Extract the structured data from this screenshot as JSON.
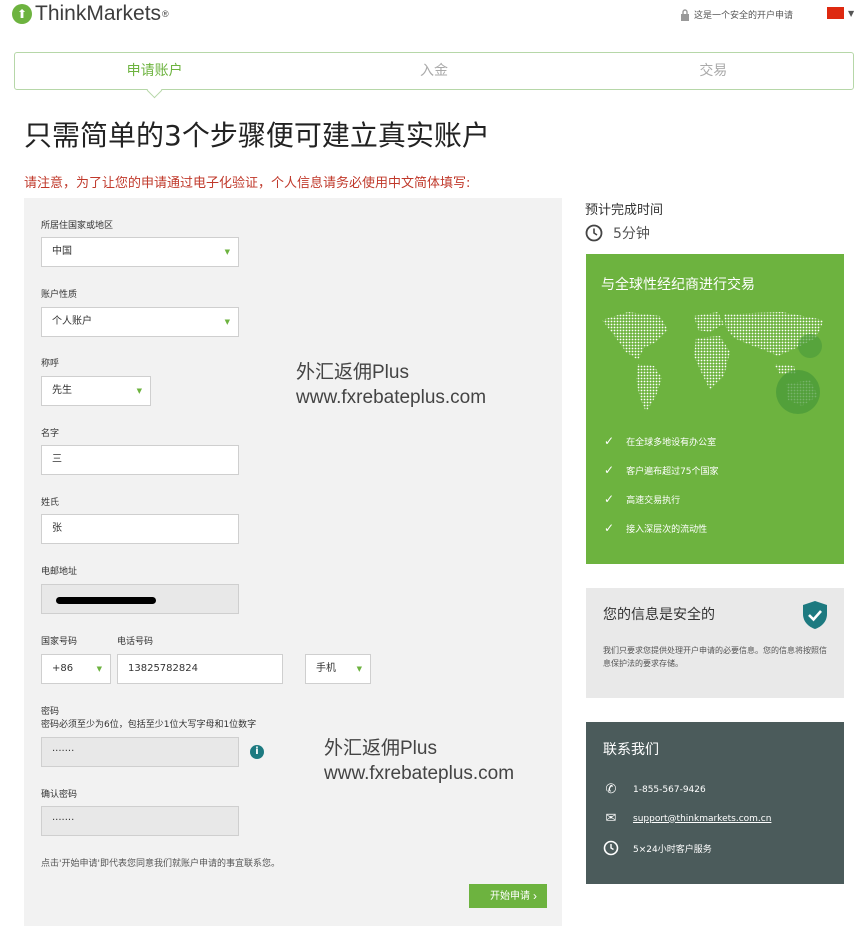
{
  "header": {
    "logo_text": "ThinkMarkets",
    "logo_reg": "®",
    "secure_text": "这是一个安全的开户申请",
    "colors": {
      "brand_green": "#6db33f",
      "flag_red": "#de2910"
    }
  },
  "steps": [
    {
      "label": "申请账户",
      "active": true
    },
    {
      "label": "入金",
      "active": false
    },
    {
      "label": "交易",
      "active": false
    }
  ],
  "title": "只需简单的3个步骤便可建立真实账户",
  "notice": "请注意，为了让您的申请通过电子化验证，个人信息请务必使用中文简体填写:",
  "form": {
    "country_label": "所居住国家或地区",
    "country_value": "中国",
    "account_type_label": "账户性质",
    "account_type_value": "个人账户",
    "salutation_label": "称呼",
    "salutation_value": "先生",
    "first_name_label": "名字",
    "first_name_value": "三",
    "last_name_label": "姓氏",
    "last_name_value": "张",
    "email_label": "电邮地址",
    "country_code_label": "国家号码",
    "country_code_value": "+86",
    "phone_label": "电话号码",
    "phone_value": "13825782824",
    "phone_type_value": "手机",
    "password_label": "密码",
    "password_hint": "密码必须至少为6位，包括至少1位大写字母和1位数字",
    "password_value": "·······",
    "confirm_label": "确认密码",
    "confirm_value": "·······",
    "info_icon_text": "i",
    "consent_text": "点击'开始申请'即代表您同意我们就账户申请的事宜联系您。",
    "start_button": "开始申请",
    "start_chevron": "›"
  },
  "watermarks": [
    {
      "line1": "外汇返佣Plus",
      "line2": "www.fxrebateplus.com"
    },
    {
      "line1": "外汇返佣Plus",
      "line2": "www.fxrebateplus.com"
    }
  ],
  "eta": {
    "label": "预计完成时间",
    "value": "5分钟"
  },
  "global": {
    "title": "与全球性经纪商进行交易",
    "features": [
      "在全球多地设有办公室",
      "客户遍布超过75个国家",
      "高速交易执行",
      "接入深层次的流动性"
    ]
  },
  "safety": {
    "title": "您的信息是安全的",
    "text": "我们只要求您提供处理开户申请的必要信息。您的信息将按照信息保护法的要求存储。"
  },
  "contact": {
    "title": "联系我们",
    "phone": "1-855-567-9426",
    "email": "support@thinkmarkets.com.cn",
    "hours": "5×24小时客户服务"
  }
}
